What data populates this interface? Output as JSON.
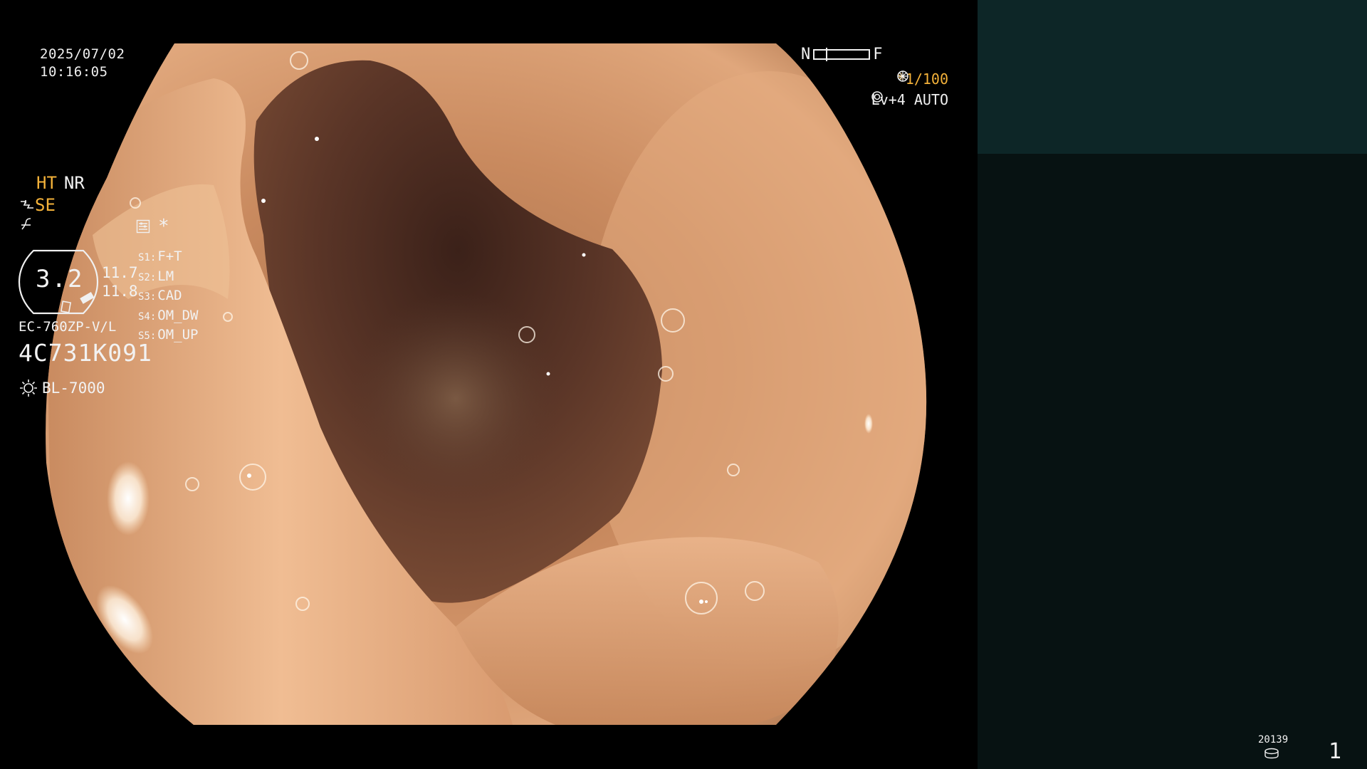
{
  "overlay": {
    "date": "2025/07/02",
    "time": "10:16:05",
    "near_far": {
      "near": "N",
      "far": "F"
    },
    "shutter": "*1/100",
    "level": "Lv+4 AUTO"
  },
  "panel": {
    "enhancement": {
      "ht": "HT",
      "nr": "NR"
    },
    "structure_mode": "SE",
    "star": "*",
    "scope_value": "3.2",
    "readings": [
      "11.7",
      "11.8"
    ],
    "switches": [
      {
        "tag": "S1:",
        "label": "F+T"
      },
      {
        "tag": "S2:",
        "label": "LM"
      },
      {
        "tag": "S3:",
        "label": "CAD"
      },
      {
        "tag": "S4:",
        "label": "OM_DW"
      },
      {
        "tag": "S5:",
        "label": "OM_UP"
      }
    ],
    "scope_model": "EC-760ZP-V/L",
    "serial": "4C731K091",
    "light_source": "BL-7000",
    "counter": "20139",
    "page": "1"
  },
  "colors": {
    "accent_orange": "#f4b23a",
    "panel_bg": "#071212",
    "panel_top": "#0d2627",
    "text": "#f2f2f2"
  },
  "icons": [
    "shutter-dial-icon",
    "auto-iris-icon",
    "structure-enhance-icon",
    "contrast-icon",
    "settings-list-icon",
    "light-source-icon",
    "disk-icon"
  ]
}
